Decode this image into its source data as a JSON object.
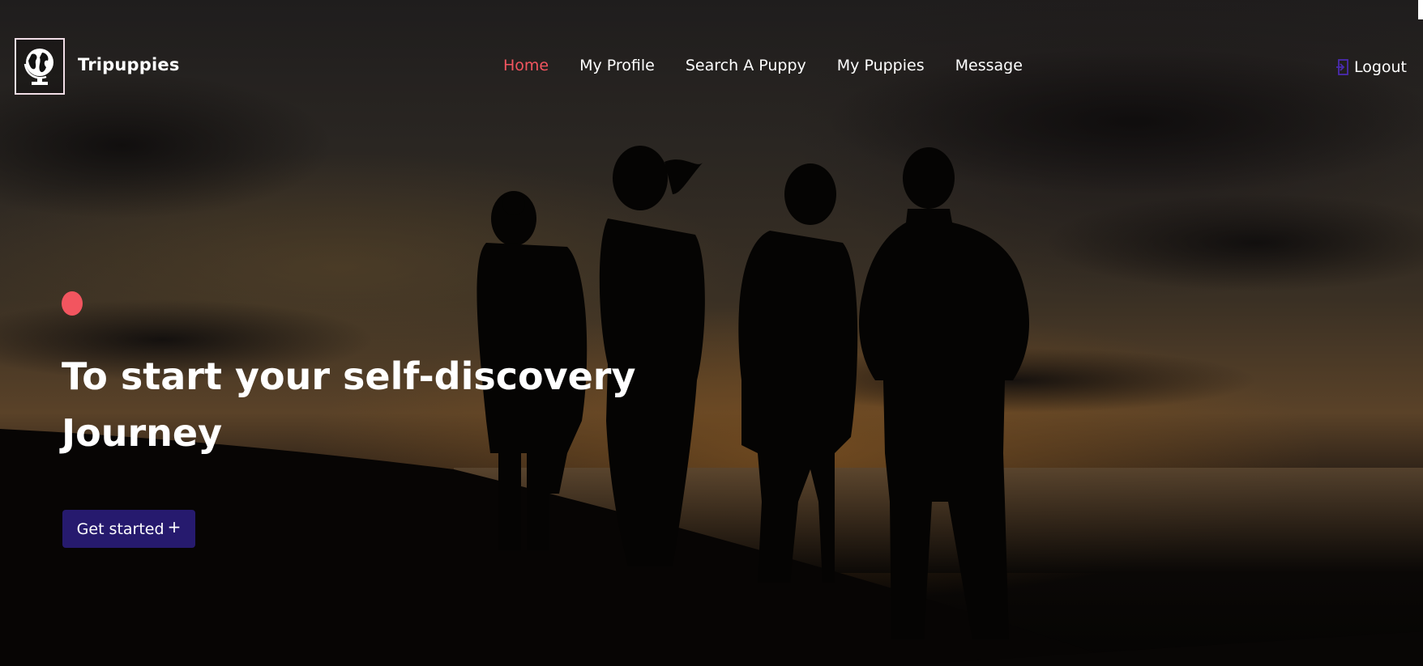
{
  "brand": {
    "name": "Tripuppies",
    "logo_icon": "globe-icon"
  },
  "nav": {
    "items": [
      {
        "label": "Home",
        "active": true
      },
      {
        "label": "My Profile",
        "active": false
      },
      {
        "label": "Search A Puppy",
        "active": false
      },
      {
        "label": "My Puppies",
        "active": false
      },
      {
        "label": "Message",
        "active": false
      }
    ],
    "logout_label": "Logout",
    "logout_icon": "logout-icon"
  },
  "hero": {
    "headline_line1": "To start your self-discovery",
    "headline_line2": "Journey",
    "cta_label": "Get started",
    "cta_icon": "+"
  },
  "colors": {
    "accent": "#f2555f",
    "button": "#261a6e",
    "text": "#ffffff"
  }
}
